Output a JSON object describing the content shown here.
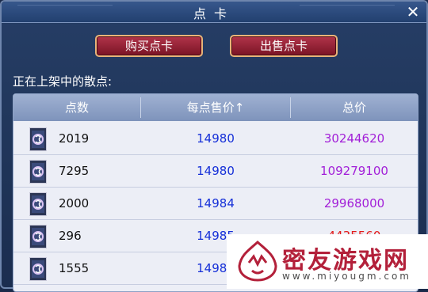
{
  "window": {
    "title": "点卡",
    "close_glyph": "✕"
  },
  "actions": {
    "buy_label": "购买点卡",
    "sell_label": "出售点卡"
  },
  "listing": {
    "label": "正在上架中的散点:",
    "headers": {
      "points": "点数",
      "unit_price": "每点售价↑",
      "total": "总价"
    },
    "rows": [
      {
        "points": "2019",
        "unit_price": "14980",
        "total": "30244620"
      },
      {
        "points": "7295",
        "unit_price": "14980",
        "total": "109279100"
      },
      {
        "points": "2000",
        "unit_price": "14984",
        "total": "29968000"
      },
      {
        "points": "296",
        "unit_price": "14985",
        "total": "4435560"
      },
      {
        "points": "1555",
        "unit_price": "14988",
        "total": ""
      }
    ]
  },
  "watermark": {
    "text": "密友游戏网",
    "url": "www.miyougm.com"
  },
  "colors": {
    "unit_price": "#1630d8",
    "total_purple": "#a21fd8",
    "total_red": "#e31a1a",
    "button": "#9a2436"
  }
}
